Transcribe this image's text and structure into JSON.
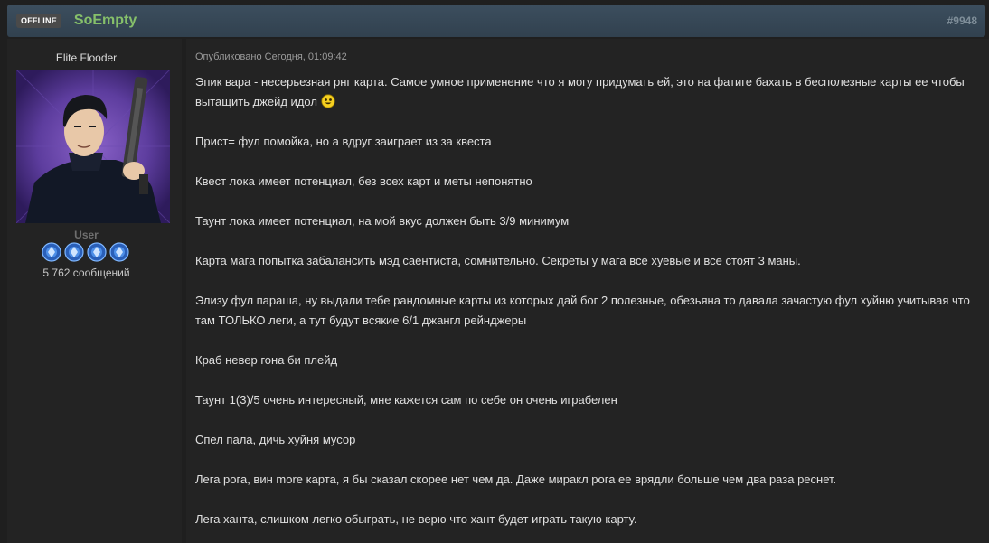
{
  "header": {
    "status_badge": "OFFLINE",
    "username": "SoEmpty",
    "post_number": "#9948"
  },
  "author": {
    "member_title": "Elite Flooder",
    "avatar": "avatar-illustration",
    "group_name": "User",
    "group_icons": [
      "rank-icon",
      "rank-icon",
      "rank-icon",
      "rank-icon"
    ],
    "post_count": "5 762 сообщений"
  },
  "post": {
    "date": "Опубликовано Сегодня, 01:09:42",
    "paragraphs": [
      "Эпик вара - несерьезная рнг карта. Самое умное применение что я могу придумать ей, это на фатиге бахать в бесполезные карты ее чтобы вытащить джейд идол",
      "Прист= фул помойка, но а вдруг заиграет из за квеста",
      "Квест лока имеет потенциал, без всех карт и меты непонятно",
      "Таунт лока имеет потенциал, на мой вкус должен быть 3/9 минимум",
      "Карта мага  попытка забалансить мэд саентиста, сомнительно. Секреты у мага все хуевые и все стоят 3 маны.",
      "Элизу фул параша, ну выдали тебе рандомные карты из которых дай бог 2 полезные, обезьяна то давала зачастую фул хуйню учитывая что там ТОЛЬКО леги, а тут будут всякие 6/1 джангл рейнджеры",
      "Краб невер гона би плейд",
      "Таунт 1(3)/5 очень интересный, мне кажется сам по себе он очень играбелен",
      "Спел пала, дичь хуйня мусор",
      "Лега рога, вин more карта, я бы сказал скорее нет чем да.  Даже миракл рога ее врядли больше чем два раза реснет.",
      "Лега ханта, слишком легко обыграть, не верю что хант будет играть такую карту."
    ],
    "emoticon": "smiley-icon"
  }
}
